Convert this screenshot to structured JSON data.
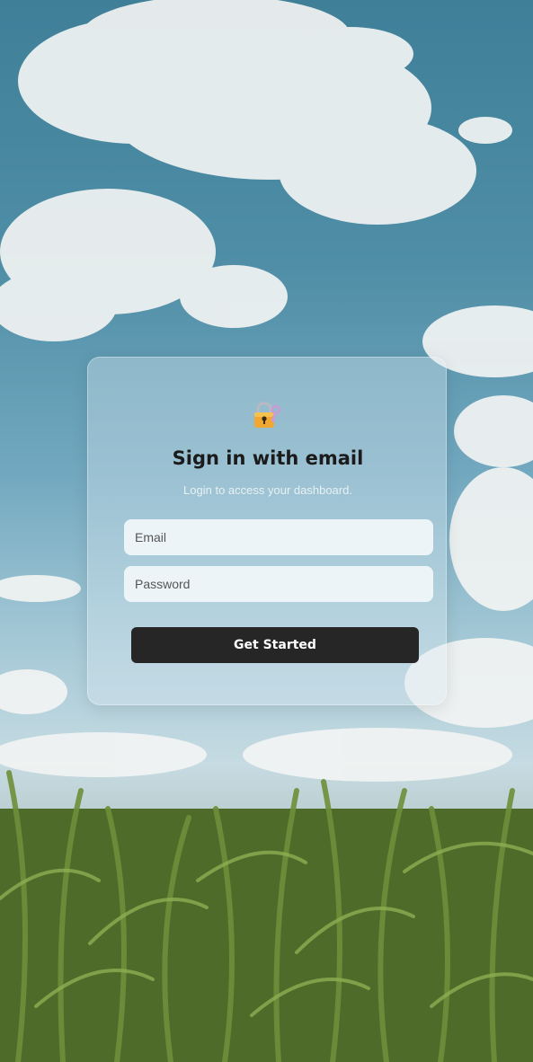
{
  "login": {
    "title": "Sign in with email",
    "subtitle": "Login to access your dashboard.",
    "email_placeholder": "Email",
    "password_placeholder": "Password",
    "submit_label": "Get Started",
    "icon": "lock-with-key-icon"
  },
  "colors": {
    "button_bg": "#262626",
    "button_text": "#ffffff",
    "title_text": "#1b1b1b",
    "sky": "#4f8ea6",
    "field": "#f2f7fa"
  }
}
